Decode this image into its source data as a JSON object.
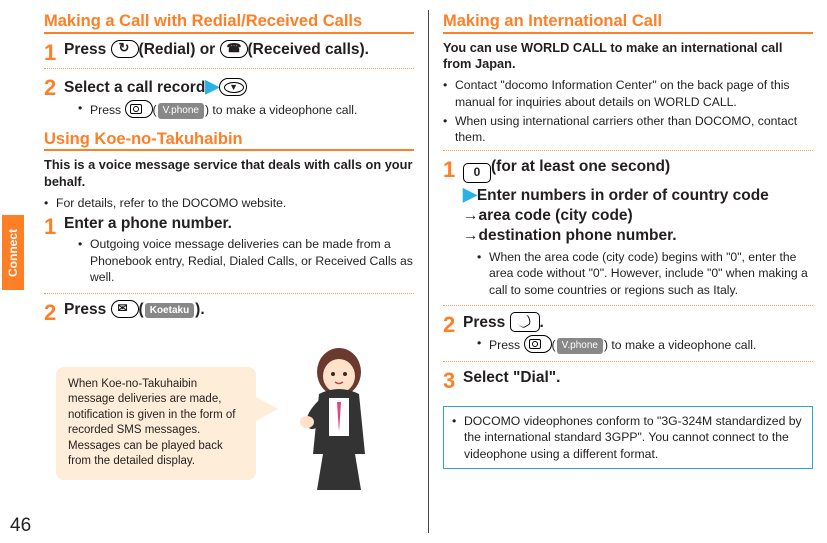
{
  "sidetab": "Connect",
  "page_number": "46",
  "left": {
    "h1": "Making a Call with Redial/Received Calls",
    "step1": {
      "pre": "Press ",
      "mid": "(Redial) or ",
      "post": "(Received calls)."
    },
    "step2": {
      "main": "Select a call record",
      "bullet_pre": "Press ",
      "bullet_soft": "V.phone",
      "bullet_post": ") to make a videophone call."
    },
    "h2": "Using Koe-no-Takuhaibin",
    "intro": "This is a voice message service that deals with calls on your behalf.",
    "intro_bullet": "For details, refer to the DOCOMO website.",
    "k_step1": {
      "main": "Enter a phone number.",
      "bullet": "Outgoing voice message deliveries can be made from a Phonebook entry, Redial, Dialed Calls, or Received Calls as well."
    },
    "k_step2": {
      "pre": "Press ",
      "soft": "Koetaku",
      "post": ")."
    },
    "speech": "When Koe-no-Takuhaibin message deliveries are made, notification is given in the form of recorded SMS messages. Messages can be played back from the detailed display."
  },
  "right": {
    "h1": "Making an International Call",
    "lead": "You can use WORLD CALL to make an international call from Japan.",
    "bullet1": "Contact \"docomo Information Center\" on the back page of this manual for inquiries about details on WORLD CALL.",
    "bullet2": "When using international carriers other than DOCOMO, contact them.",
    "step1": {
      "line1_post": "(for at least one second)",
      "line2": "Enter numbers in order of country code",
      "line3": "area code (city code)",
      "line4": "destination phone number.",
      "bullet": "When the area code (city code) begins with \"0\", enter the area code without \"0\". However, include \"0\" when making a call to some countries or regions such as Italy."
    },
    "step2": {
      "main_pre": "Press ",
      "main_post": ".",
      "bullet_pre": "Press ",
      "bullet_soft": "V.phone",
      "bullet_post": ") to make a videophone call."
    },
    "step3": "Select \"Dial\".",
    "callout": "DOCOMO videophones conform to \"3G-324M standardized by the international standard 3GPP\". You cannot connect to the videophone using a different format."
  },
  "icons": {
    "redial": "redial-key-icon",
    "received": "received-calls-key-icon",
    "nav_down": "nav-down-key-icon",
    "camera": "camera-key-icon",
    "mail": "mail-key-icon",
    "zero": "0",
    "call": "call-key-icon"
  }
}
